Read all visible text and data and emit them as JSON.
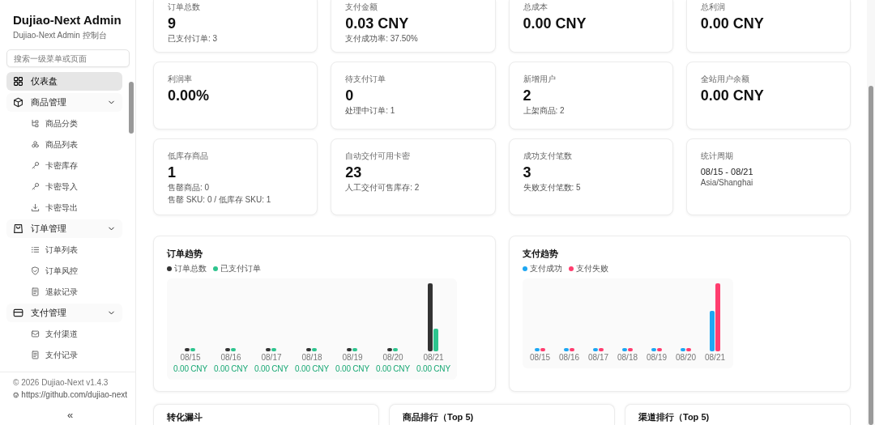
{
  "sidebar": {
    "title": "Dujiao-Next Admin",
    "subtitle": "Dujiao-Next Admin 控制台",
    "search": {
      "placeholder": "搜索一级菜单或页面"
    },
    "menu": [
      {
        "kind": "link",
        "label": "仪表盘",
        "selected": true
      },
      {
        "kind": "group",
        "label": "商品管理",
        "selected": false,
        "expanded": true,
        "children": [
          {
            "label": "商品分类",
            "selected": false
          },
          {
            "label": "商品列表",
            "selected": false
          },
          {
            "label": "卡密库存",
            "selected": false
          },
          {
            "label": "卡密导入",
            "selected": false
          },
          {
            "label": "卡密导出",
            "selected": false
          }
        ]
      },
      {
        "kind": "group",
        "label": "订单管理",
        "selected": false,
        "expanded": true,
        "children": [
          {
            "label": "订单列表",
            "selected": false
          },
          {
            "label": "订单风控",
            "selected": false
          },
          {
            "label": "退款记录",
            "selected": false
          }
        ]
      },
      {
        "kind": "group",
        "label": "支付管理",
        "selected": false,
        "expanded": true,
        "children": [
          {
            "label": "支付渠道",
            "selected": false
          },
          {
            "label": "支付记录",
            "selected": false
          }
        ]
      }
    ],
    "footer": {
      "copyright": "© 2026 Dujiao-Next v1.4.3",
      "link": "https://github.com/dujiao-next"
    },
    "collapse": "«"
  },
  "stats": [
    {
      "kind": "metric",
      "label": "订单总数",
      "value": "9",
      "notes": [
        "已支付订单: 3"
      ]
    },
    {
      "kind": "metric",
      "label": "支付金额",
      "value": "0.03 CNY",
      "notes": [
        "支付成功率: 37.50%"
      ]
    },
    {
      "kind": "metric",
      "label": "总成本",
      "value": "0.00 CNY"
    },
    {
      "kind": "metric",
      "label": "总利润",
      "value": "0.00 CNY"
    },
    {
      "kind": "metric",
      "label": "利润率",
      "value": "0.00%"
    },
    {
      "kind": "metric",
      "label": "待支付订单",
      "value": "0",
      "notes": [
        "处理中订单: 1"
      ]
    },
    {
      "kind": "metric",
      "label": "新增用户",
      "value": "2",
      "notes": [
        "上架商品: 2"
      ]
    },
    {
      "kind": "metric",
      "label": "全站用户余额",
      "value": "0.00 CNY"
    },
    {
      "kind": "metric",
      "label": "低库存商品",
      "value": "1",
      "notes": [
        "售罄商品: 0",
        "售罄 SKU: 0 / 低库存 SKU: 1"
      ]
    },
    {
      "kind": "metric",
      "label": "自动交付可用卡密",
      "value": "23",
      "notes": [
        "人工交付可售库存: 2"
      ]
    },
    {
      "kind": "metric",
      "label": "成功支付笔数",
      "value": "3",
      "notes": [
        "失败支付笔数: 5"
      ]
    },
    {
      "kind": "period",
      "label": "统计周期",
      "value": "08/15 - 08/21",
      "notes": [
        "Asia/Shanghai"
      ]
    }
  ],
  "charts": [
    {
      "title": "订单趋势",
      "legend": [
        {
          "label": "订单总数",
          "color": "#333333"
        },
        {
          "label": "已支付订单",
          "color": "#2ec48e"
        }
      ],
      "dates": [
        "08/15",
        "08/16",
        "08/17",
        "08/18",
        "08/19",
        "08/20",
        "08/21"
      ],
      "amounts": [
        "0.00 CNY",
        "0.00 CNY",
        "0.00 CNY",
        "0.00 CNY",
        "0.00 CNY",
        "0.00 CNY",
        "0.00 CNY"
      ]
    },
    {
      "title": "支付趋势",
      "legend": [
        {
          "label": "支付成功",
          "color": "#1ea7f2"
        },
        {
          "label": "支付失败",
          "color": "#ff3d6e"
        }
      ],
      "dates": [
        "08/15",
        "08/16",
        "08/17",
        "08/18",
        "08/19",
        "08/20",
        "08/21"
      ]
    }
  ],
  "panels": [
    {
      "title": "转化漏斗"
    },
    {
      "title": "商品排行（Top 5)"
    },
    {
      "title": "渠道排行（Top 5)"
    }
  ]
}
